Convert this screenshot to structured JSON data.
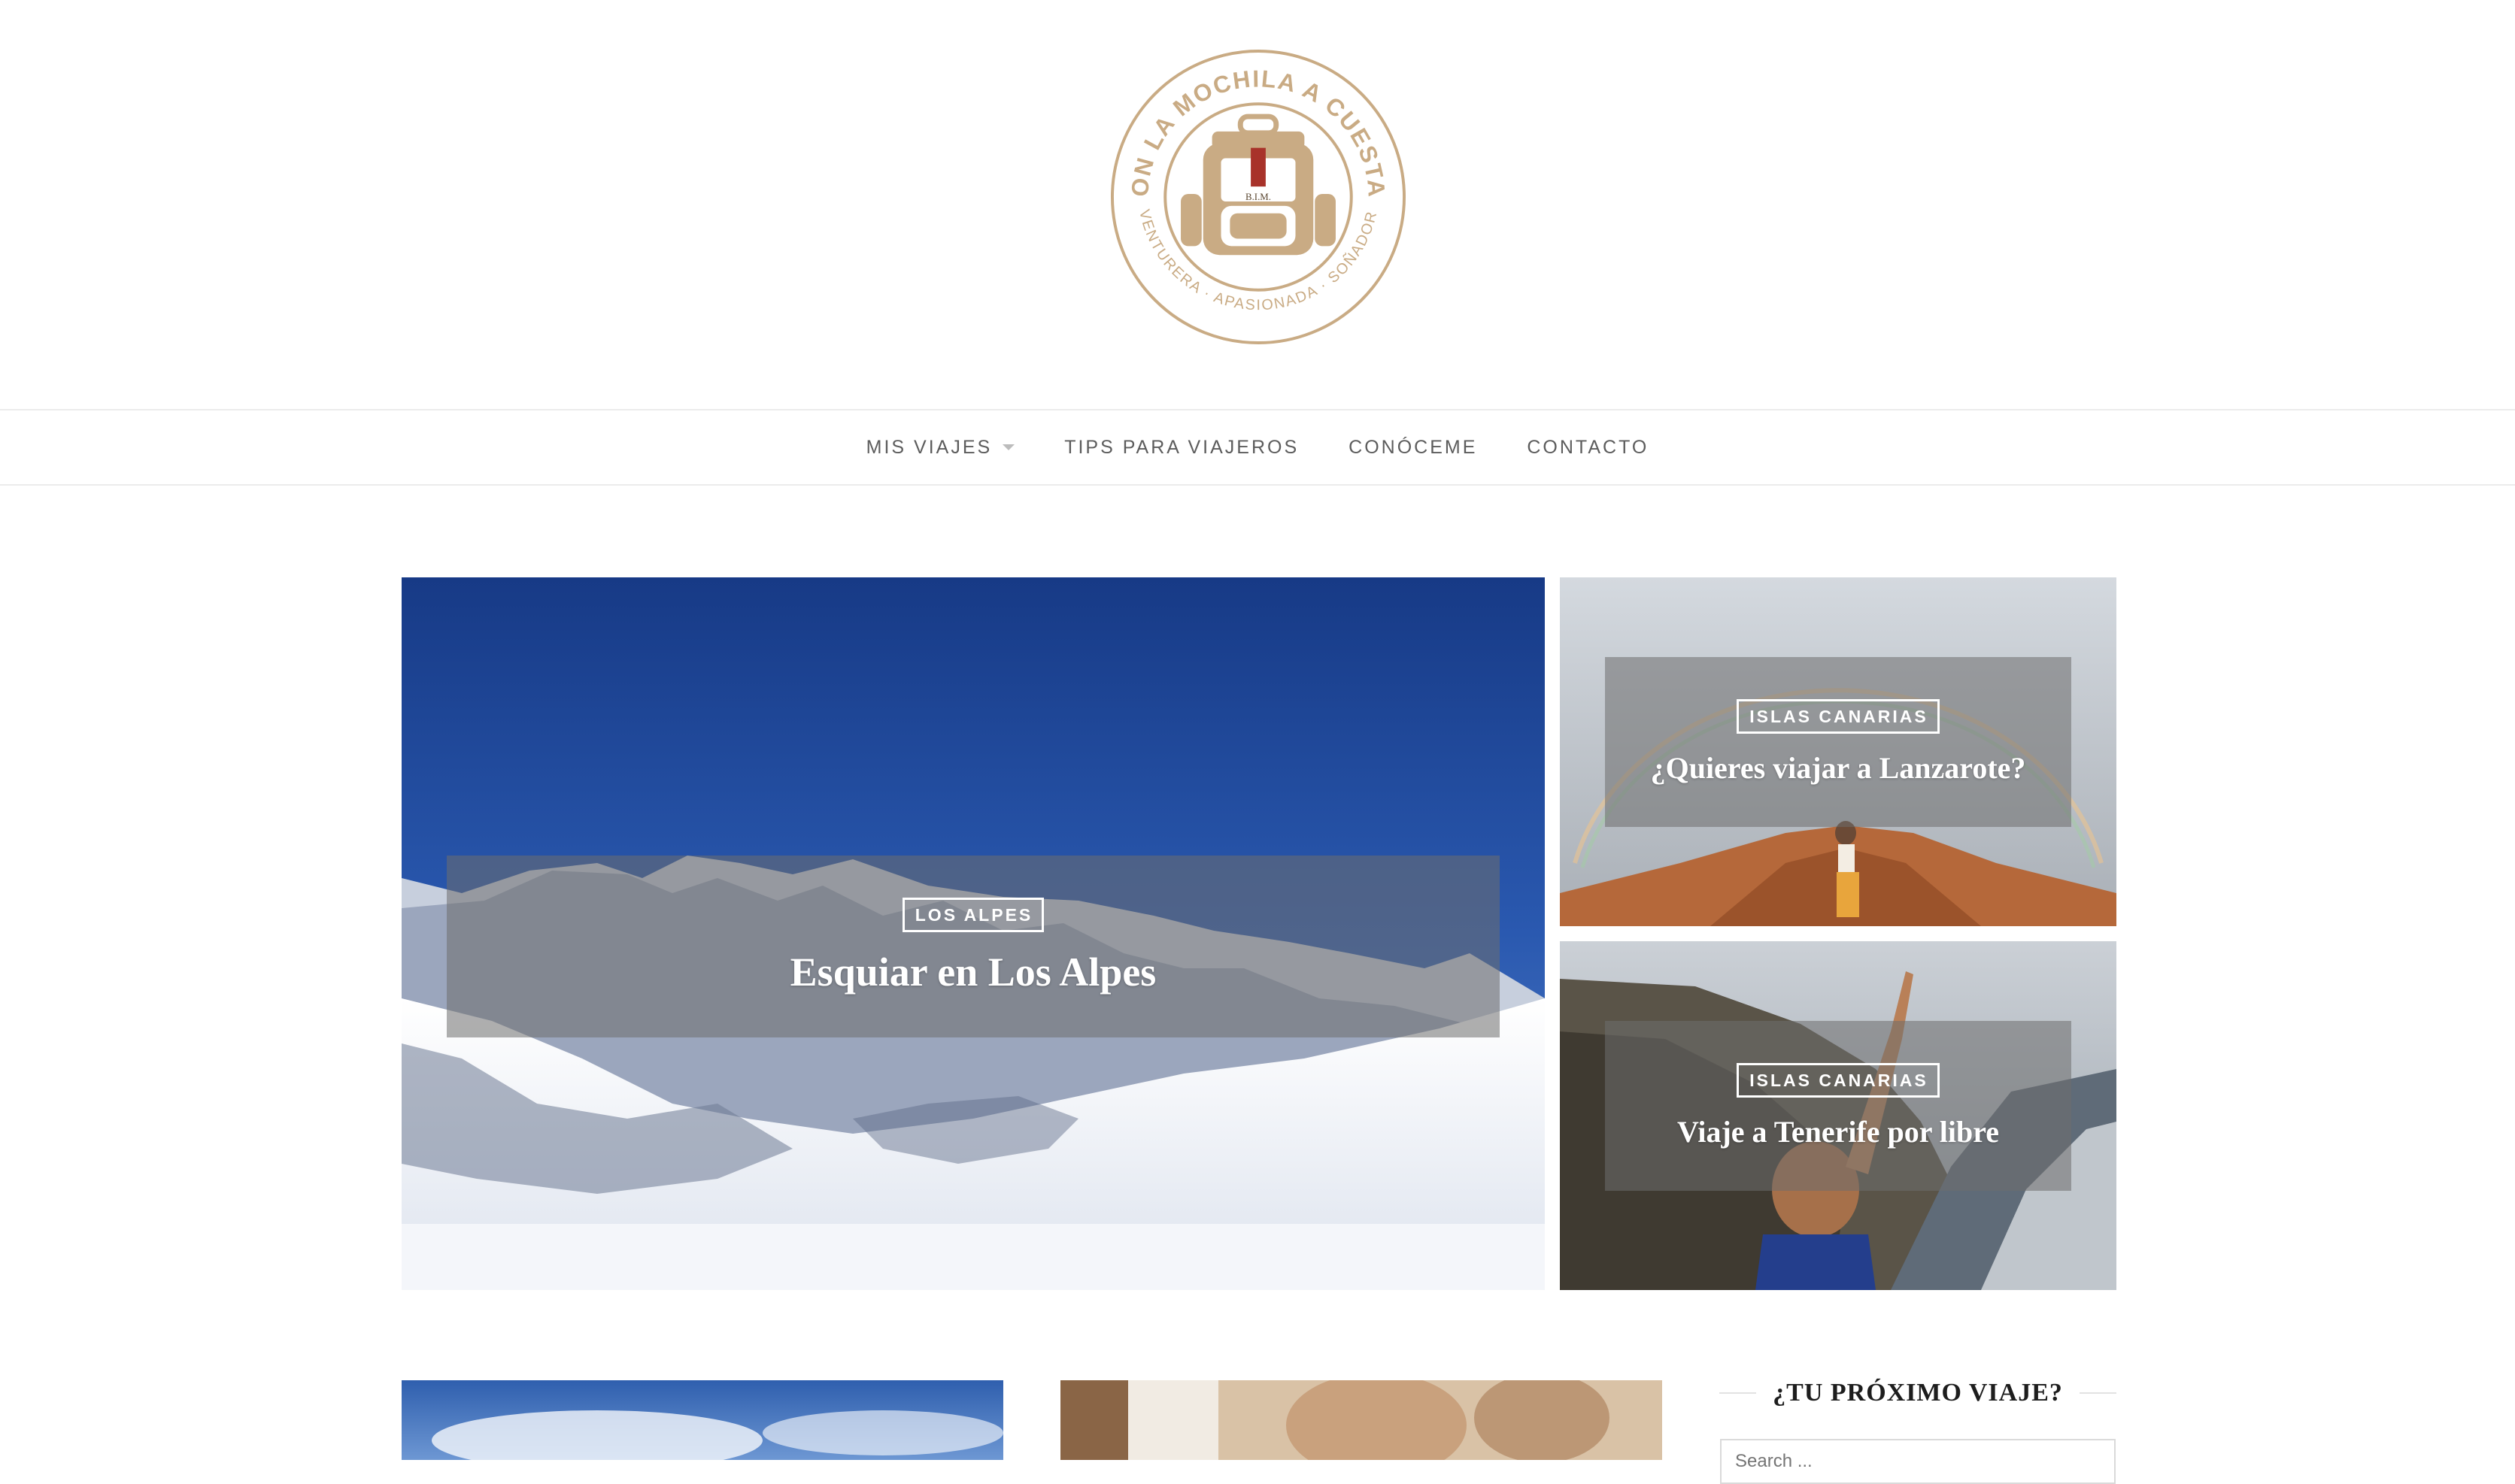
{
  "logo": {
    "arc_top": "CON LA MOCHILA A CUESTAS",
    "arc_bottom": "AVENTURERA · APASIONADA · SOÑADORA",
    "initials": "B.I.M.",
    "color": "#c9ab84"
  },
  "nav": {
    "items": [
      {
        "label": "MIS VIAJES",
        "has_dropdown": true
      },
      {
        "label": "TIPS PARA VIAJEROS",
        "has_dropdown": false
      },
      {
        "label": "CONÓCEME",
        "has_dropdown": false
      },
      {
        "label": "CONTACTO",
        "has_dropdown": false
      }
    ]
  },
  "featured": {
    "main": {
      "category": "LOS ALPES",
      "title": "Esquiar en Los Alpes"
    },
    "side_top": {
      "category": "ISLAS CANARIAS",
      "title": "¿Quieres viajar a Lanzarote?"
    },
    "side_bottom": {
      "category": "ISLAS CANARIAS",
      "title": "Viaje a Tenerife por libre"
    }
  },
  "sidebar": {
    "widget_title": "¿TU PRÓXIMO VIAJE?",
    "search_placeholder": "Search ..."
  }
}
